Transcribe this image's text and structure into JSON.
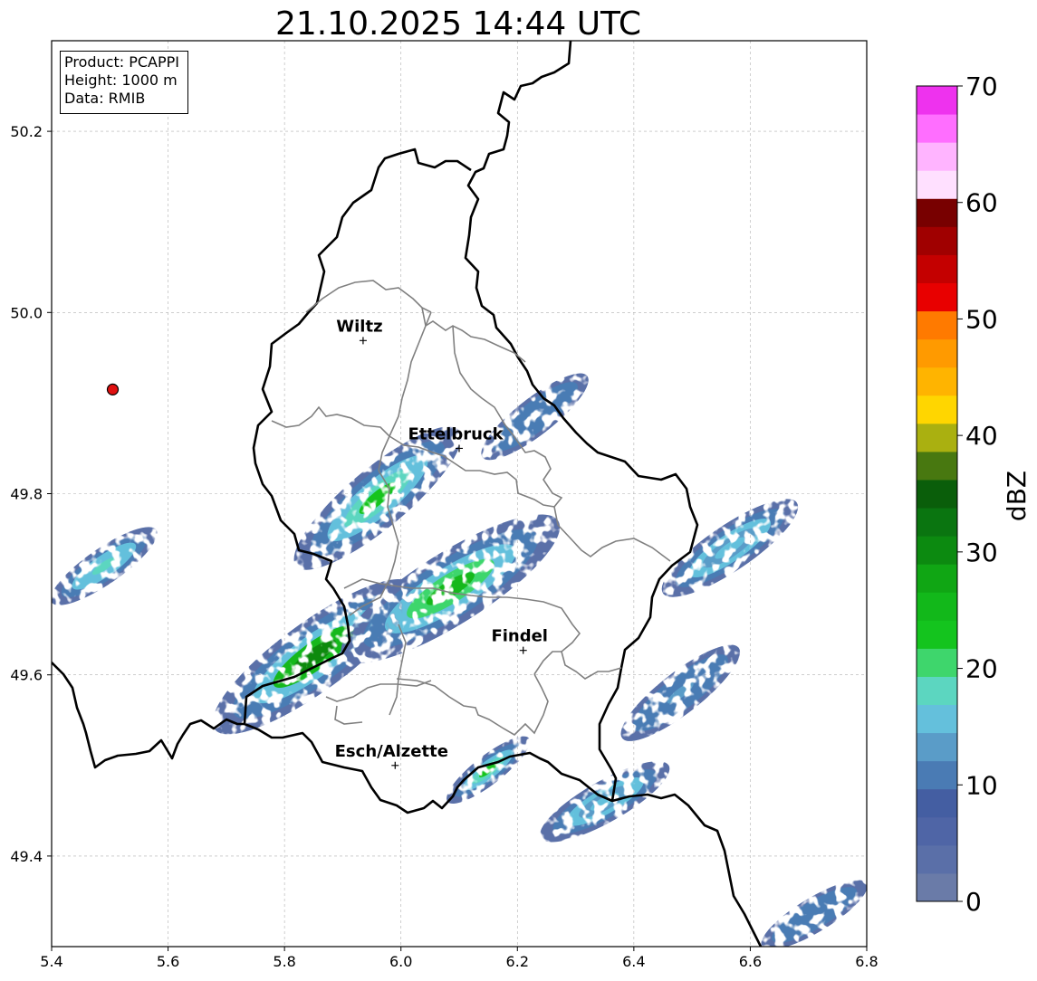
{
  "title": "21.10.2025 14:44 UTC",
  "info": {
    "product": "Product: PCAPPI",
    "height": "Height: 1000 m",
    "data": "Data: RMIB"
  },
  "chart_data": {
    "type": "heatmap",
    "xlim": [
      5.4,
      6.8
    ],
    "ylim": [
      49.3,
      50.3
    ],
    "x_ticks": [
      "5.4",
      "5.6",
      "5.8",
      "6.0",
      "6.2",
      "6.4",
      "6.6",
      "6.8"
    ],
    "y_ticks": [
      "49.4",
      "49.6",
      "49.8",
      "50.0",
      "50.2"
    ],
    "grid": true,
    "cities": [
      {
        "name": "Wiltz",
        "lon": 5.935,
        "lat": 49.969
      },
      {
        "name": "Ettelbruck",
        "lon": 6.1,
        "lat": 49.85
      },
      {
        "name": "Findel",
        "lon": 6.21,
        "lat": 49.627
      },
      {
        "name": "Esch/Alzette",
        "lon": 5.99,
        "lat": 49.5
      }
    ],
    "radar_site": {
      "lon": 5.505,
      "lat": 49.915,
      "color": "#e01010"
    },
    "colorbar": {
      "label": "dBZ",
      "range": [
        0,
        70
      ],
      "tick_labels": [
        "0",
        "10",
        "20",
        "30",
        "40",
        "50",
        "60",
        "70"
      ],
      "colors": [
        "#6a7ba8",
        "#5a6fa8",
        "#4f65a6",
        "#445ea2",
        "#4a7bb4",
        "#5a9cc8",
        "#64c0dc",
        "#5cd6c0",
        "#3ed66c",
        "#14c41e",
        "#12b81a",
        "#10a614",
        "#0c8a10",
        "#0a7510",
        "#0a5e0a",
        "#487810",
        "#aab010",
        "#ffd600",
        "#ffb400",
        "#ff9a00",
        "#ff7a00",
        "#e80000",
        "#c40000",
        "#a00000",
        "#780000",
        "#ffe0ff",
        "#ffb4ff",
        "#ff6eff",
        "#ee32ee"
      ]
    },
    "echo_bands": [
      {
        "name": "southwest-main-band",
        "x": [
          5.68,
          6.02
        ],
        "y": [
          49.54,
          49.7
        ],
        "max_dbz": 30
      },
      {
        "name": "central-band",
        "x": [
          5.9,
          6.27
        ],
        "y": [
          49.62,
          49.77
        ],
        "max_dbz": 25
      },
      {
        "name": "northwest-band",
        "x": [
          5.82,
          6.1
        ],
        "y": [
          49.72,
          49.87
        ],
        "max_dbz": 22
      },
      {
        "name": "northeast-cells",
        "x": [
          6.14,
          6.32
        ],
        "y": [
          49.84,
          49.93
        ],
        "max_dbz": 12
      },
      {
        "name": "east-band",
        "x": [
          6.45,
          6.68
        ],
        "y": [
          49.69,
          49.79
        ],
        "max_dbz": 15
      },
      {
        "name": "southeast-band-1",
        "x": [
          6.38,
          6.58
        ],
        "y": [
          49.53,
          49.63
        ],
        "max_dbz": 14
      },
      {
        "name": "southeast-band-2",
        "x": [
          6.24,
          6.46
        ],
        "y": [
          49.42,
          49.5
        ],
        "max_dbz": 16
      },
      {
        "name": "south-cell",
        "x": [
          6.08,
          6.22
        ],
        "y": [
          49.46,
          49.53
        ],
        "max_dbz": 22
      },
      {
        "name": "west-edge-band",
        "x": [
          5.4,
          5.58
        ],
        "y": [
          49.68,
          49.76
        ],
        "max_dbz": 18
      },
      {
        "name": "far-southeast-band",
        "x": [
          6.62,
          6.8
        ],
        "y": [
          49.3,
          49.37
        ],
        "max_dbz": 12
      }
    ]
  }
}
